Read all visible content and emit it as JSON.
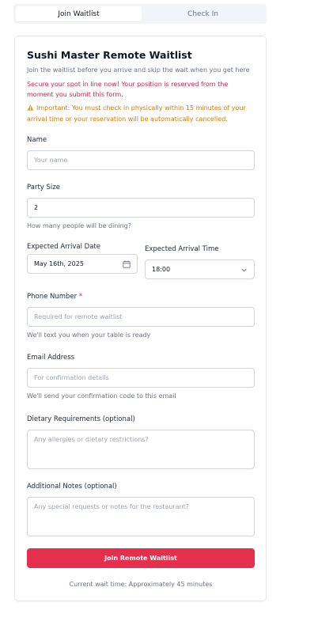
{
  "tabs": [
    {
      "label": "Join Waitlist",
      "active": true
    },
    {
      "label": "Check In",
      "active": false
    }
  ],
  "form": {
    "title": "Sushi Master Remote Waitlist",
    "subtitle": "Join the waitlist before you arrive and skip the wait when you get here",
    "notice": "Secure your spot in line now! Your position is reserved from the moment you submit this form.",
    "warning_icon": "warning-icon",
    "warning": "Important: You must check in physically within 15 minutes of your arrival time or your reservation will be automatically cancelled.",
    "name": {
      "label": "Name",
      "placeholder": "Your name"
    },
    "party_size": {
      "label": "Party Size",
      "value": "2",
      "help": "How many people will be dining?"
    },
    "arrival_date": {
      "label": "Expected Arrival Date",
      "value": "May 16th, 2025",
      "icon": "calendar-icon"
    },
    "arrival_time": {
      "label": "Expected Arrival Time",
      "value": "18:00",
      "icon": "chevron-down-icon"
    },
    "phone": {
      "label": "Phone Number",
      "required_mark": "*",
      "placeholder": "Required for remote waitlist",
      "help": "We'll text you when your table is ready"
    },
    "email": {
      "label": "Email Address",
      "placeholder": "For confirmation details",
      "help": "We'll send your confirmation code to this email"
    },
    "dietary": {
      "label": "Dietary Requirements (optional)",
      "placeholder": "Any allergies or dietary restrictions?"
    },
    "notes": {
      "label": "Additional Notes (optional)",
      "placeholder": "Any special requests or notes for the restaurant?"
    },
    "submit_label": "Join Remote Waitlist",
    "wait_time": "Current wait time: Approximately 45 minutes"
  },
  "colors": {
    "accent": "#e5304d",
    "notice": "#e11d48",
    "warning": "#d97706"
  }
}
